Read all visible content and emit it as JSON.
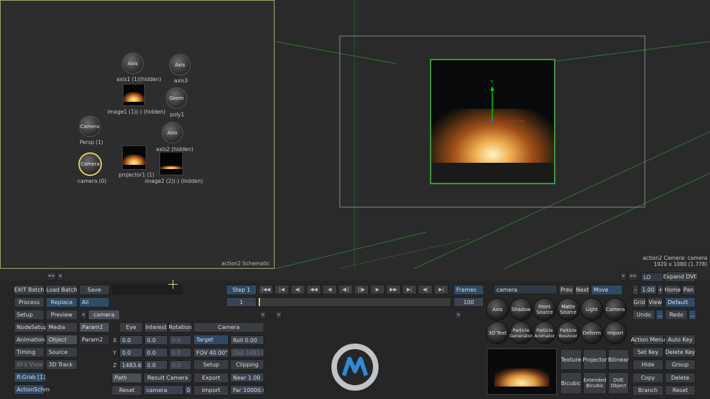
{
  "schematic": {
    "title": "action2 Schematic",
    "nodes": [
      {
        "label": "Axis",
        "caption": "axis1 (1)(hidden)"
      },
      {
        "label": "Axis",
        "caption": "axis3"
      },
      {
        "label": "",
        "caption": "image1 (1)(-) (hidden)"
      },
      {
        "label": "Geom",
        "caption": "poly1"
      },
      {
        "label": "Camera",
        "caption": "Persp (1)"
      },
      {
        "label": "Axis",
        "caption": "axis2 (hidden)"
      },
      {
        "label": "Camera",
        "caption": "camera (0)"
      },
      {
        "label": "",
        "caption": "projector1 (1)"
      },
      {
        "label": "",
        "caption": "image2 (2)(-) (hidden)"
      }
    ]
  },
  "viewport": {
    "info_line1": "action2 Camera: camera",
    "info_line2": "1920 x 1080 (1.778)",
    "axis_y": "Y"
  },
  "scroll": {
    "left1": "<<",
    "left2": "<",
    "right1": ">",
    "right2": ">>"
  },
  "left_panel": {
    "exit_batch": "EXIT Batch",
    "load_batch": "Load Batch",
    "save": "Save",
    "process": "Process",
    "replace": "Replace",
    "all": "All",
    "setup": "Setup",
    "preview": "Preview",
    "tab_camera": "camera",
    "node_setup": "NodeSetup",
    "media": "Media",
    "param1": "Param1",
    "animation": "Animation",
    "object": "Object",
    "param2": "Param2",
    "timing": "Timing",
    "source": "Source",
    "bfx_view": "BFX View",
    "track_3d": "3D Track",
    "rgrab": "R:Grab [1]",
    "action_schm": "ActionSchm"
  },
  "camera_panel": {
    "eye": "Eye",
    "interest": "Interest",
    "rotation": "Rotation",
    "x": "X",
    "y": "Y",
    "z": "Z",
    "eye_x": "0.0",
    "eye_y": "0.0",
    "eye_z": "1483.6",
    "int_x": "0.0",
    "int_y": "0.0",
    "int_z": "0.0",
    "rot_x": "0.0",
    "rot_y": "0.0",
    "rot_z": "0.0",
    "path": "Path",
    "result_camera": "Result Camera",
    "reset": "Reset",
    "camera_field": "camera",
    "zero": "0",
    "camera_header": "Camera",
    "target": "Target",
    "roll": "Roll 0.00",
    "fov": "FOV 40.00°",
    "dist": "Dist 1483.64",
    "setup": "Setup",
    "clipping": "Clipping",
    "export": "Export",
    "near": "Near 1.00",
    "import": "Import",
    "far": "Far 10000.00"
  },
  "transport": {
    "step": "Step 1",
    "frames": "Frames",
    "current": "1",
    "end": "100",
    "buttons": [
      "|◀◀",
      "|◀",
      "◀|",
      "◀◀",
      "◀",
      "◀||",
      "||▶",
      "▶",
      "▶▶",
      "▶|",
      "◀|",
      "▶|"
    ]
  },
  "object_panel": {
    "field": "camera",
    "prev": "Prev",
    "next": "Next",
    "move": "Move",
    "spheres": [
      "Axis",
      "Shadow",
      "Front Source",
      "Matte Source",
      "Light",
      "Camera",
      "3D Text",
      "Particle Generator",
      "Particle Animator",
      "Particle Bouncer",
      "Deform",
      "Import"
    ],
    "texture": "Texture",
    "projector": "Projector",
    "bilinear": "Bilinear",
    "bicubic": "Bicubic",
    "ext_bicubic": "Extended Bicubic",
    "dve_object": "DVE Object"
  },
  "right_panel": {
    "lo": "LO",
    "expand_dve": "Expand DVE",
    "minus": "-",
    "zoom": "1.00",
    "plus": "+",
    "home": "Home",
    "pan": "Pan",
    "grid": "Grid",
    "view": "View",
    "default": "Default",
    "undo": "Undo",
    "dots": "...",
    "redo": "Redo",
    "action_menu": "Action Menu",
    "auto_key": "Auto Key",
    "set_key": "Set Key",
    "delete_key": "Delete Key",
    "hide": "Hide",
    "group": "Group",
    "copy": "Copy",
    "delete": "Delete",
    "branch": "Branch",
    "reset": "Reset"
  },
  "colors": {
    "accent_green": "#00c800",
    "frame_green": "#3a9a3a",
    "selection_yellow": "#e0d060"
  }
}
